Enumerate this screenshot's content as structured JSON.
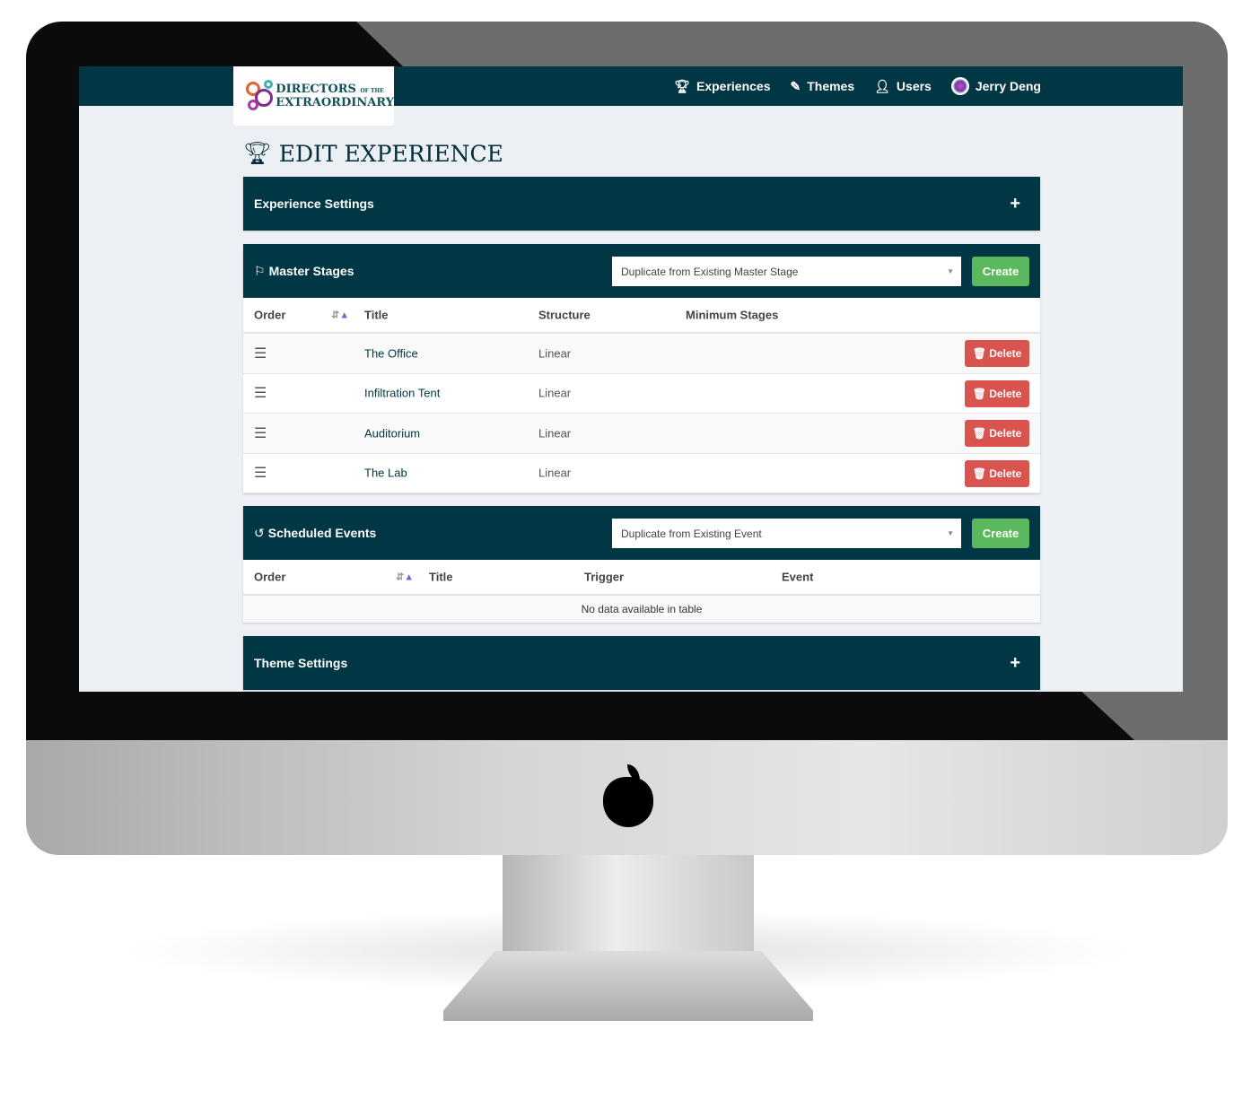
{
  "nav": {
    "logo_line1": "DIRECTORS",
    "logo_of": "OF THE",
    "logo_line2": "EXTRAORDINARY",
    "items": [
      {
        "label": "Experiences",
        "icon": "trophy-icon"
      },
      {
        "label": "Themes",
        "icon": "eyedropper-icon"
      },
      {
        "label": "Users",
        "icon": "user-icon"
      },
      {
        "label": "Jerry Deng",
        "icon": "avatar"
      }
    ]
  },
  "page": {
    "title": "EDIT EXPERIENCE"
  },
  "experience_settings": {
    "title": "Experience Settings",
    "toggle": "+"
  },
  "master_stages": {
    "title": "Master Stages",
    "select": "Duplicate from Existing Master Stage",
    "create": "Create",
    "columns": [
      "Order",
      "Title",
      "Structure",
      "Minimum Stages"
    ],
    "rows": [
      {
        "title": "The Office",
        "structure": "Linear"
      },
      {
        "title": "Infiltration Tent",
        "structure": "Linear"
      },
      {
        "title": "Auditorium",
        "structure": "Linear"
      },
      {
        "title": "The Lab",
        "structure": "Linear"
      }
    ],
    "delete": "Delete"
  },
  "scheduled_events": {
    "title": "Scheduled Events",
    "select": "Duplicate from Existing Event",
    "create": "Create",
    "columns": [
      "Order",
      "Title",
      "Trigger",
      "Event"
    ],
    "empty": "No data available in table"
  },
  "theme_settings": {
    "title": "Theme Settings",
    "toggle": "+"
  },
  "colors": {
    "primary": "#013744",
    "success": "#5cb85c",
    "danger": "#d9534f"
  }
}
